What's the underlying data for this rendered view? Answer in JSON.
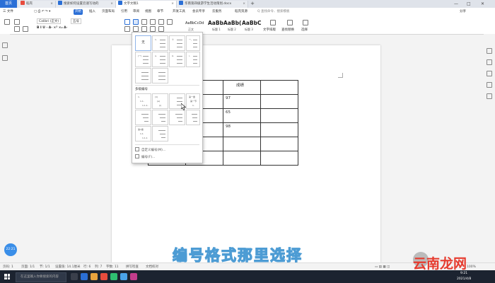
{
  "tabs": {
    "home": "首页",
    "items": [
      {
        "label": "稻壳",
        "icon_color": "#e84c3d"
      },
      {
        "label": "搜索如何设置云速写动的",
        "icon_color": "#2b6fd6"
      },
      {
        "label": "文字文稿1",
        "icon_color": "#2b6fd6",
        "active": true
      },
      {
        "label": "华南第四级游学生活动策划.docx",
        "icon_color": "#2b6fd6"
      }
    ]
  },
  "window_controls": {
    "minimize": "—",
    "restore": "□",
    "close": "✕"
  },
  "menu": {
    "file": "三 文件",
    "items": [
      "开始",
      "插入",
      "页面布局",
      "引用",
      "审阅",
      "视图",
      "章节",
      "开发工具",
      "会员专享",
      "云服务",
      "稻壳资源"
    ],
    "active": "开始",
    "search": "Q 查找命令、搜索模板",
    "share": "分享"
  },
  "ribbon": {
    "font_name": "Calibri (正文)",
    "font_size": "五号",
    "styles": [
      {
        "preview": "AaBbCcDd",
        "label": "正文"
      },
      {
        "preview": "AaBb",
        "label": "标题 1"
      },
      {
        "preview": "AaBb(",
        "label": "标题 2"
      },
      {
        "preview": "AaBbC",
        "label": "标题 3"
      }
    ],
    "tools": [
      "文字排版",
      "查找替换",
      "选择"
    ]
  },
  "numbering_dropdown": {
    "none_label": "无",
    "section_title": "多级编号",
    "multilevel_labels": [
      [
        "1.",
        "1.1.",
        "1.1.1."
      ],
      [
        "(1)",
        "(a)",
        "(i)"
      ],
      [
        "第一章",
        "第一节",
        "1."
      ],
      [
        "第1章",
        "1.1",
        "1.1.1"
      ]
    ],
    "cell_labels": [
      "1.",
      "①",
      "一、",
      "(一)",
      "a.",
      "A.",
      "i."
    ],
    "links": [
      "自定义编号(M)...",
      "编号(F)..."
    ]
  },
  "table": {
    "rows": [
      [
        "",
        "",
        "成绩",
        ""
      ],
      [
        "",
        "",
        "97",
        ""
      ],
      [
        "",
        "",
        "65",
        ""
      ],
      [
        "",
        "",
        "98",
        ""
      ],
      [
        "",
        "",
        "",
        ""
      ],
      [
        "",
        "",
        "",
        ""
      ]
    ]
  },
  "caption": "编号格式那里选择",
  "avatar": "22:21",
  "status": {
    "page": "页码: 1",
    "pages": "页面: 1/1",
    "section": "节: 1/1",
    "setting": "设置值: 14.1厘米",
    "row": "行: 6",
    "col": "列: 7",
    "words": "字数: 11",
    "spell": "拼写检查",
    "doc": "文档校对",
    "zoom": "100%"
  },
  "taskbar": {
    "search_placeholder": "在这里输入你要搜索的内容",
    "time": "9:21",
    "date": "2021/4/8"
  },
  "watermark": "云南龙网"
}
